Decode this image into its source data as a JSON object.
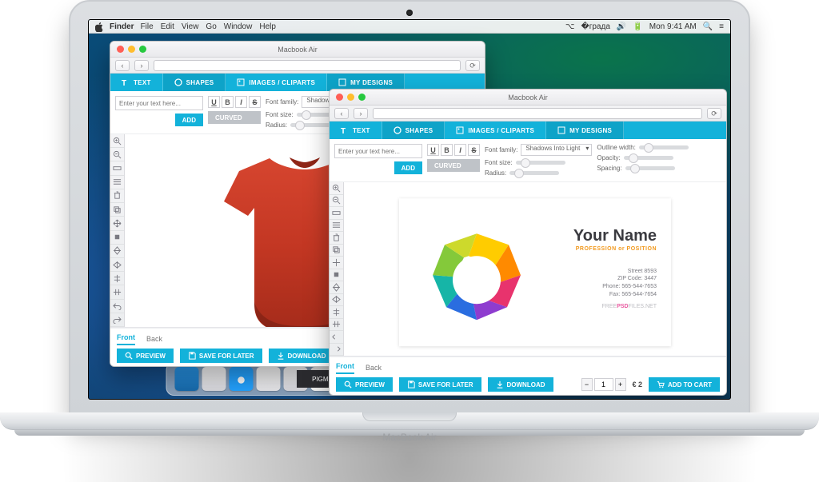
{
  "menubar": {
    "app": "Finder",
    "items": [
      "File",
      "Edit",
      "View",
      "Go",
      "Window",
      "Help"
    ],
    "clock": "Mon 9:41 AM"
  },
  "window_title": "Macbook Air",
  "tabs": {
    "text": "TEXT",
    "shapes": "SHAPES",
    "images": "IMAGES / CLIPARTS",
    "mydesigns": "MY DESIGNS"
  },
  "textpanel": {
    "placeholder": "Enter your text here...",
    "add": "ADD",
    "curved": "CURVED",
    "font_family_label": "Font family:",
    "font_family_value": "Shadows Into Light",
    "font_size_label": "Font size:",
    "radius_label": "Radius:",
    "outline_width_label": "Outline width:",
    "opacity_label": "Opacity:",
    "spacing_label": "Spacing:"
  },
  "views": {
    "front": "Front",
    "back": "Back"
  },
  "footer": {
    "preview": "PREVIEW",
    "save": "SAVE FOR LATER",
    "download": "DOWNLOAD",
    "qty": "1",
    "price": "€ 2",
    "add_to_cart": "ADD TO CART"
  },
  "bizcard": {
    "name": "Your Name",
    "subtitle": "PROFESSION or POSITION",
    "addr1": "Street 8593",
    "addr2": "ZIP Code: 3447",
    "addr3": "Phone: 565-544-7653",
    "addr4": "Fax: 565-544-7654",
    "site_pre": "FREE",
    "site_mid": "PSD",
    "site_post": "FILES.NET"
  },
  "laptop_brand": "MacBook Air",
  "pigments": "PIGMENTS"
}
